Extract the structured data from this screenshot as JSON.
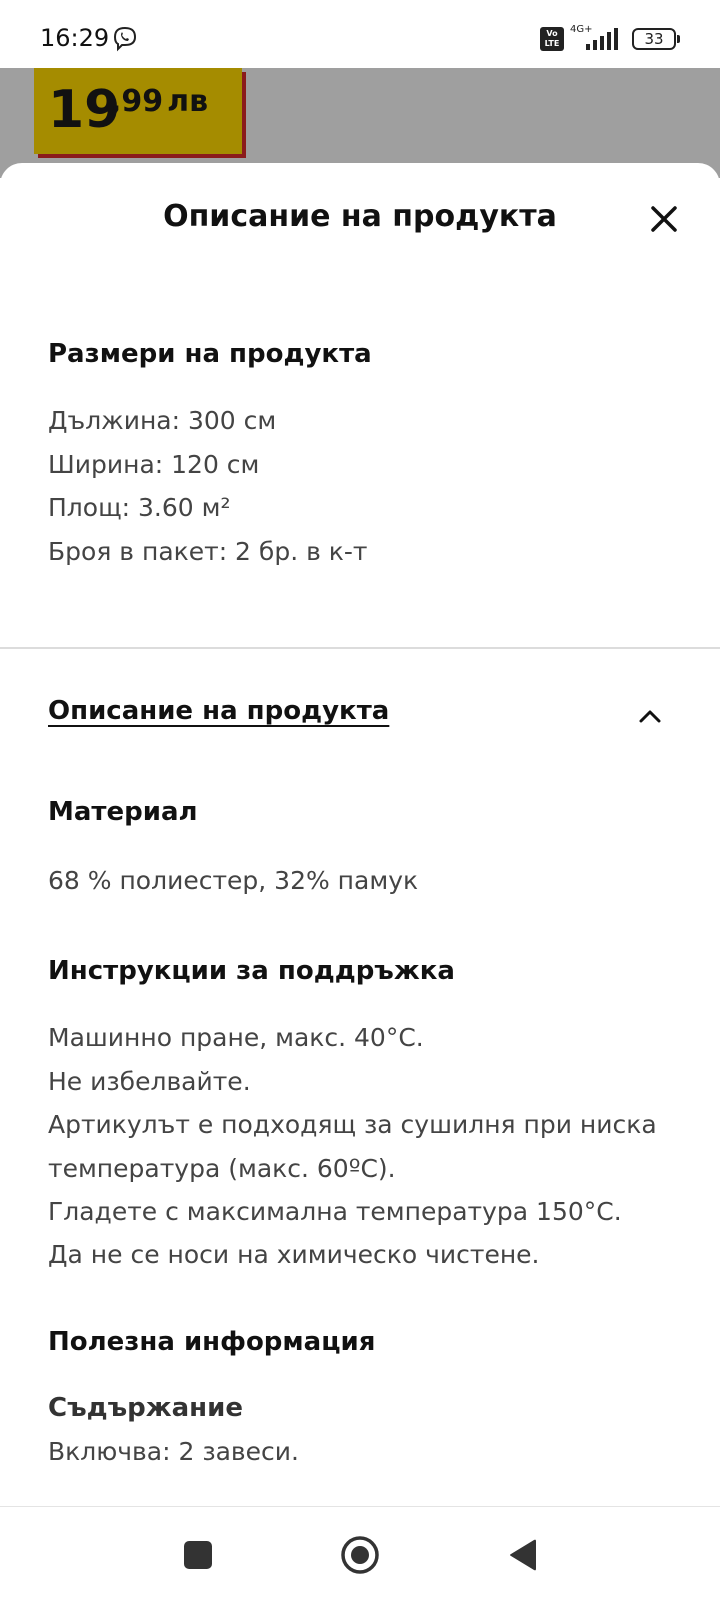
{
  "status_bar": {
    "time": "16:29",
    "volte_label": "Vo LTE",
    "network_label": "4G+",
    "battery_level": "33",
    "icons": [
      "viber-icon",
      "signal-icon",
      "battery-icon"
    ]
  },
  "backdrop": {
    "price_integer": "19",
    "price_fraction": ",99",
    "price_currency": "лв",
    "price_color": "#a58c00"
  },
  "sheet": {
    "title": "Описание на продукта",
    "dimensions": {
      "heading": "Размери на продукта",
      "lines": [
        "Дължина: 300 см",
        "Ширина: 120 см",
        "Площ: 3.60 м²",
        "Броя в пакет: 2 бр. в к-т"
      ]
    },
    "description": {
      "header": "Описание на продукта",
      "material_heading": "Материал",
      "material_text": "68 % полиестер, 32% памук",
      "care_heading": "Инструкции за поддръжка",
      "care_lines": [
        "Машинно пране, макс. 40°C.",
        "Не избелвайте.",
        "Артикулът е подходящ за сушилня при ниска",
        "температура (макс. 60ºC).",
        "Гладете с максимална температура 150°C.",
        "Да не се носи на химическо чистене."
      ],
      "useful_heading": "Полезна информация",
      "contents_heading": "Съдържание",
      "contents_text": "Включва: 2 завеси."
    }
  },
  "nav_bar": {
    "icons": [
      "nav-square-icon",
      "nav-home-icon",
      "nav-back-icon"
    ]
  }
}
